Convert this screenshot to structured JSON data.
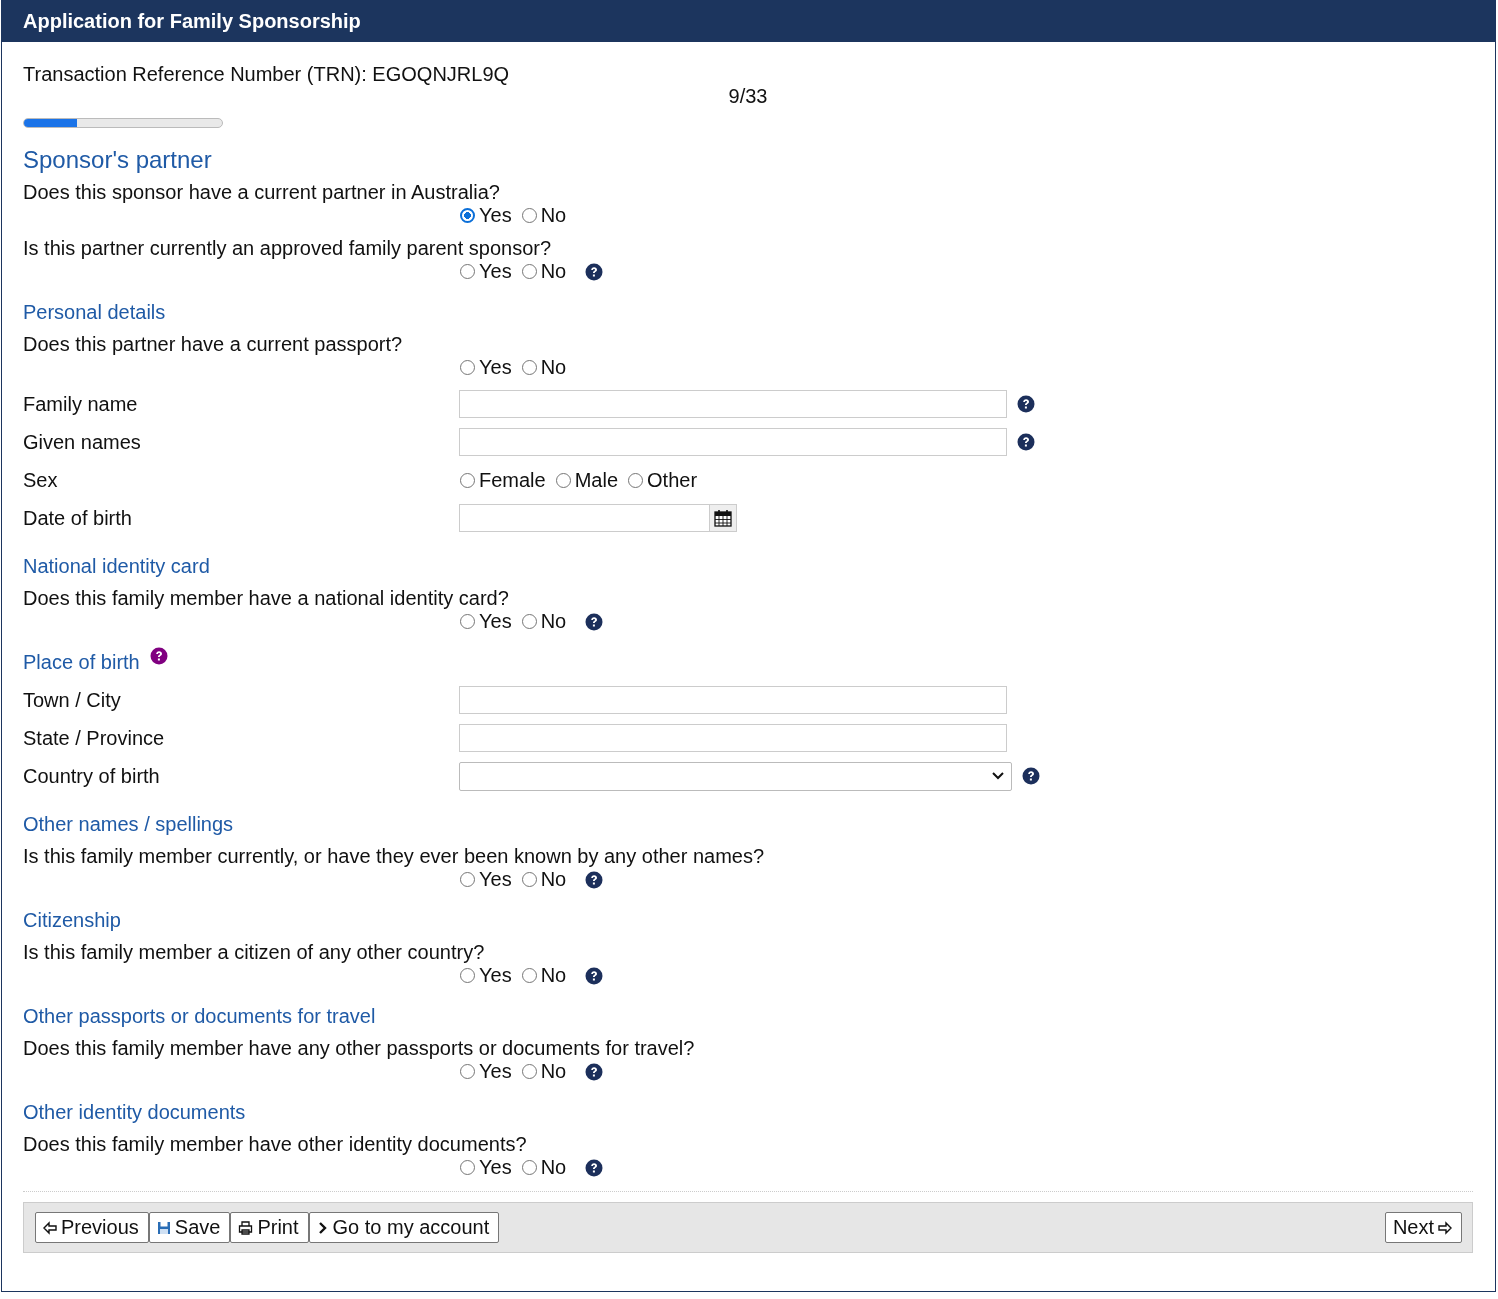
{
  "title": "Application for Family Sponsorship",
  "trn": "Transaction Reference Number (TRN): EGOQNJRL9Q",
  "progress": {
    "reading": "9/33",
    "level": 0.27
  },
  "sections": [
    {
      "heading": "Sponsor's partner",
      "kind": "main",
      "items": [
        {
          "kind": "question",
          "label": "Does this sponsor have a current partner in Australia?",
          "help": false,
          "options": [
            {
              "label": "Yes",
              "selected": true
            },
            {
              "label": "No",
              "selected": false
            }
          ]
        },
        {
          "kind": "question",
          "label": "Is this partner currently an approved family parent sponsor?",
          "help": true,
          "options": [
            {
              "label": "Yes",
              "selected": false
            },
            {
              "label": "No",
              "selected": false
            }
          ]
        }
      ]
    },
    {
      "heading": "Personal details",
      "kind": "sub",
      "items": [
        {
          "kind": "question",
          "label": "Does this partner have a current passport?",
          "help": false,
          "options": [
            {
              "label": "Yes",
              "selected": false
            },
            {
              "label": "No",
              "selected": false
            }
          ]
        },
        {
          "kind": "text",
          "label": "Family name",
          "help": true
        },
        {
          "kind": "text",
          "label": "Given names",
          "help": true
        },
        {
          "kind": "choice",
          "label": "Sex",
          "options": [
            {
              "label": "Female",
              "selected": false
            },
            {
              "label": "Male",
              "selected": false
            },
            {
              "label": "Other",
              "selected": false
            }
          ]
        },
        {
          "kind": "date",
          "label": "Date of birth"
        }
      ]
    },
    {
      "heading": "National identity card",
      "kind": "sub",
      "items": [
        {
          "kind": "question",
          "label": "Does this family member have a national identity card?",
          "help": true,
          "options": [
            {
              "label": "Yes",
              "selected": false
            },
            {
              "label": "No",
              "selected": false
            }
          ]
        }
      ]
    },
    {
      "heading": "Place of birth",
      "kind": "sub",
      "heading_help": true,
      "items": [
        {
          "kind": "text",
          "label": "Town / City",
          "help": false
        },
        {
          "kind": "text",
          "label": "State / Province",
          "help": false
        },
        {
          "kind": "select",
          "label": "Country of birth",
          "help": true
        }
      ]
    },
    {
      "heading": "Other names / spellings",
      "kind": "sub",
      "items": [
        {
          "kind": "question",
          "label": "Is this family member currently, or have they ever been known by any other names?",
          "help": true,
          "options": [
            {
              "label": "Yes",
              "selected": false
            },
            {
              "label": "No",
              "selected": false
            }
          ]
        }
      ]
    },
    {
      "heading": "Citizenship",
      "kind": "sub",
      "items": [
        {
          "kind": "question",
          "label": "Is this family member a citizen of any other country?",
          "help": true,
          "options": [
            {
              "label": "Yes",
              "selected": false
            },
            {
              "label": "No",
              "selected": false
            }
          ]
        }
      ]
    },
    {
      "heading": "Other passports or documents for travel",
      "kind": "sub",
      "items": [
        {
          "kind": "question",
          "label": "Does this family member have any other passports or documents for travel?",
          "help": true,
          "options": [
            {
              "label": "Yes",
              "selected": false
            },
            {
              "label": "No",
              "selected": false
            }
          ]
        }
      ]
    },
    {
      "heading": "Other identity documents",
      "kind": "sub",
      "items": [
        {
          "kind": "question",
          "label": "Does this family member have other identity documents?",
          "help": true,
          "options": [
            {
              "label": "Yes",
              "selected": false
            },
            {
              "label": "No",
              "selected": false
            }
          ]
        }
      ]
    }
  ],
  "footer": {
    "left": [
      {
        "kind": "previous",
        "label": "Previous"
      },
      {
        "kind": "save",
        "label": "Save"
      },
      {
        "kind": "print",
        "label": "Print"
      },
      {
        "kind": "account",
        "label": "Go to my account"
      }
    ],
    "right": [
      {
        "kind": "next",
        "label": "Next"
      }
    ]
  }
}
